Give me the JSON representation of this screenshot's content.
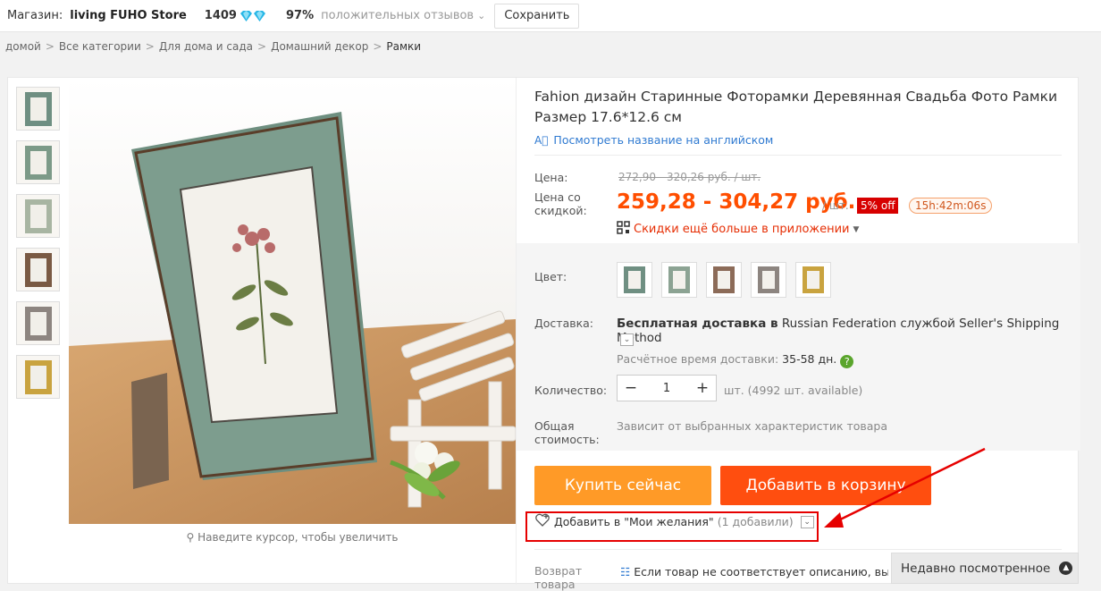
{
  "topbar": {
    "store_label": "Магазин:",
    "store_name": "living FUHO Store",
    "score": "1409",
    "feedback_pct": "97%",
    "feedback_text": "положительных отзывов",
    "save_label": "Сохранить"
  },
  "breadcrumb": [
    "домой",
    "Все категории",
    "Для дома и сада",
    "Домашний декор",
    "Рамки"
  ],
  "product": {
    "title": "Fahion дизайн Старинные Фоторамки Деревянная Свадьба Фото Рамки Размер 17.6*12.6 см",
    "translate_link": "Посмотреть название на английском",
    "price_label": "Цена:",
    "old_price": "272,90 - 320,26 руб. / шт.",
    "discount_label": "Цена со скидкой:",
    "price": "259,28 - 304,27 руб.",
    "per_unit": "/ шт.",
    "discount_badge": "5% off",
    "timer": "15h:42m:06s",
    "app_promo": "Скидки ещё больше в приложении",
    "zoom_hint": "Наведите курсор, чтобы увеличить"
  },
  "options": {
    "color_label": "Цвет:",
    "shipping_label": "Доставка:",
    "shipping_free": "Бесплатная доставка в",
    "shipping_rest": "Russian Federation службой Seller's Shipping Method",
    "eta_label": "Расчётное время доставки:",
    "eta_days": "35-58 дн.",
    "help": "?",
    "qty_label": "Количество:",
    "qty_value": "1",
    "qty_minus": "−",
    "qty_plus": "+",
    "availability": "шт. (4992 шт. available)",
    "total_label": "Общая стоимость:",
    "total_value": "Зависит от выбранных характеристик товара"
  },
  "actions": {
    "buy_now": "Купить сейчас",
    "add_to_cart": "Добавить в корзину",
    "wishlist": "Добавить в \"Мои желания\"",
    "wishlist_count": "(1 добавили)"
  },
  "return": {
    "label": "Возврат товара",
    "text": "Если товар не соответствует описанию, вы м... оплатив стоимость обратной пересылки, или..."
  },
  "recent": {
    "label": "Недавно посмотренное"
  },
  "colors": {
    "accent_orange": "#ff9a27",
    "cart_red": "#ff4e0f",
    "price": "#ff4e00",
    "link": "#2f7ad1",
    "annotation": "#e60000"
  }
}
